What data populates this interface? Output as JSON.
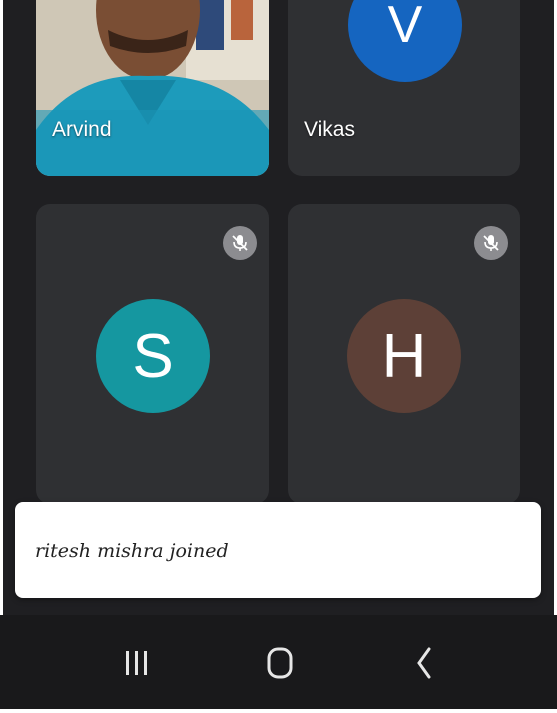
{
  "participants": [
    {
      "name": "Arvind",
      "has_video": true
    },
    {
      "name": "Vikas",
      "initial": "V",
      "avatar_color": "#1565c0"
    },
    {
      "name": "",
      "initial": "S",
      "avatar_color": "#1597a0",
      "muted": true
    },
    {
      "name": "",
      "initial": "H",
      "avatar_color": "#5d4037",
      "muted": true
    }
  ],
  "toast": {
    "message": "ritesh mishra joined"
  },
  "navbar": {
    "recents_icon": "recent-apps-icon",
    "home_icon": "home-icon",
    "back_icon": "back-icon"
  }
}
